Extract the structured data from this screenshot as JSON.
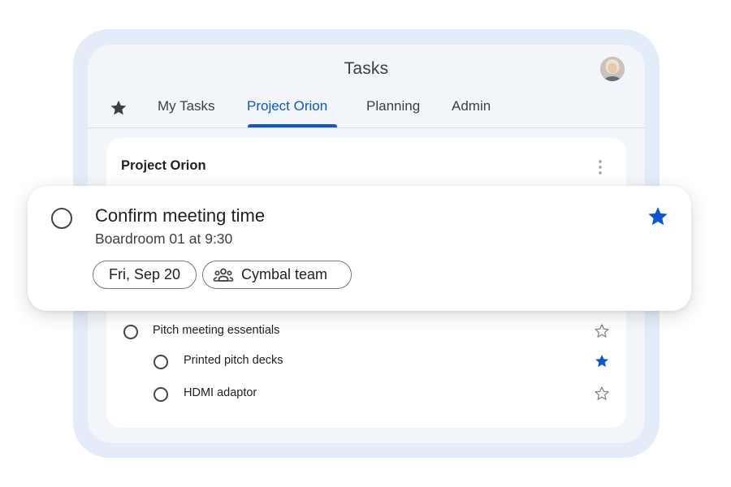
{
  "app": {
    "title": "Tasks",
    "avatar_icon": "user-avatar"
  },
  "tabs": [
    {
      "label": "My Tasks",
      "active": false
    },
    {
      "label": "Project Orion",
      "active": true
    },
    {
      "label": "Planning",
      "active": false
    },
    {
      "label": "Admin",
      "active": false
    }
  ],
  "starred_tab_icon": "star-icon",
  "list": {
    "title": "Project Orion",
    "menu_icon": "more-vert-icon",
    "tasks": [
      {
        "label": "Pitch meeting essentials",
        "starred": false,
        "level": 0
      },
      {
        "label": "Printed pitch decks",
        "starred": true,
        "level": 1
      },
      {
        "label": "HDMI adaptor",
        "starred": false,
        "level": 1
      }
    ]
  },
  "focused_task": {
    "title": "Confirm meeting time",
    "details": "Boardroom 01 at 9:30",
    "date_chip": "Fri, Sep 20",
    "team_chip": "Cymbal team",
    "team_icon": "group-icon",
    "starred": true
  },
  "colors": {
    "accent": "#0b57d0",
    "frame": "#e3ecf8",
    "window": "#f2f5fa"
  }
}
